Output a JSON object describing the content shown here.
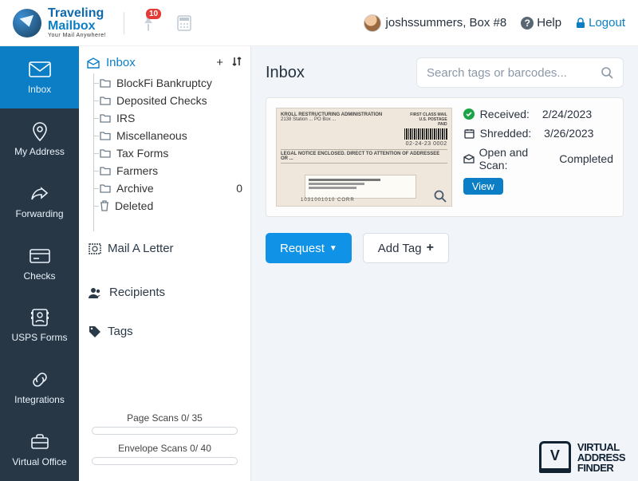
{
  "header": {
    "logo_line1": "Traveling",
    "logo_line2": "Mailbox",
    "logo_sub": "Your Mail Anywhere!",
    "pin_badge": "10",
    "user_label": "joshssummers, Box #8",
    "help_label": "Help",
    "logout_label": "Logout"
  },
  "sidebar": {
    "items": [
      {
        "label": "Inbox",
        "icon": "envelope"
      },
      {
        "label": "My Address",
        "icon": "pin"
      },
      {
        "label": "Forwarding",
        "icon": "share"
      },
      {
        "label": "Checks",
        "icon": "card"
      },
      {
        "label": "USPS Forms",
        "icon": "id"
      },
      {
        "label": "Integrations",
        "icon": "link"
      },
      {
        "label": "Virtual Office",
        "icon": "briefcase"
      }
    ]
  },
  "folders": {
    "header": "Inbox",
    "items": [
      {
        "label": "BlockFi Bankruptcy"
      },
      {
        "label": "Deposited Checks"
      },
      {
        "label": "IRS"
      },
      {
        "label": "Miscellaneous"
      },
      {
        "label": "Tax Forms"
      },
      {
        "label": "Farmers"
      },
      {
        "label": "Archive",
        "count": "0"
      },
      {
        "label": "Deleted",
        "trash": true
      }
    ],
    "mail_a_letter": "Mail A Letter",
    "recipients": "Recipients",
    "tags": "Tags",
    "page_scans": "Page Scans 0/ 35",
    "envelope_scans": "Envelope Scans 0/ 40"
  },
  "main": {
    "title": "Inbox",
    "search_placeholder": "Search tags or barcodes...",
    "envelope": {
      "sender_line1": "KROLL RESTRUCTURING ADMINISTRATION",
      "sender_line2": "2138 Station ... PO Box ...",
      "stamp": "FIRST CLASS MAIL\nU.S. POSTAGE\nPAID",
      "date_code": "02-24-23 0002",
      "legal": "LEGAL NOTICE ENCLOSED. DIRECT TO ATTENTION OF ADDRESSEE OR ...",
      "footer": "1031001010 CORR"
    },
    "meta": {
      "received_label": "Received:",
      "received_value": "2/24/2023",
      "shredded_label": "Shredded:",
      "shredded_value": "3/26/2023",
      "scan_label": "Open and Scan:",
      "scan_value": "Completed",
      "view": "View"
    },
    "request_btn": "Request",
    "addtag_btn": "Add Tag"
  },
  "watermark": {
    "v": "V",
    "l1": "VIRTUAL",
    "l2": "ADDRESS",
    "l3": "FINDER"
  }
}
